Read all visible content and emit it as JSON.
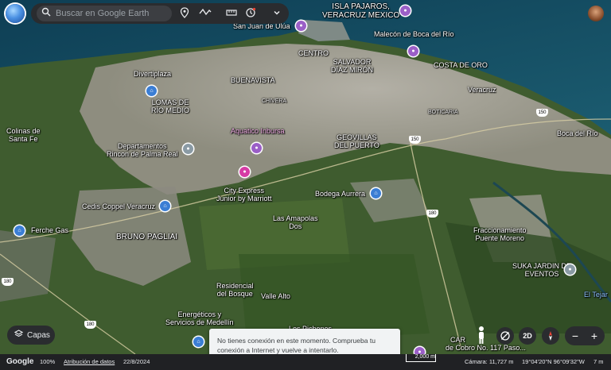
{
  "search": {
    "placeholder": "Buscar en Google Earth"
  },
  "toolbar": {
    "search_icon": "search-icon",
    "pin_icon": "place-icon",
    "path_icon": "path-icon",
    "ruler_icon": "ruler-icon",
    "history_icon": "history-icon",
    "chevron_icon": "chevron-down-icon"
  },
  "labels": {
    "isla_pajaros": "ISLA PAJAROS,",
    "isla_pajaros2": "VERACRUZ MEXICO",
    "san_juan": "San Juan de Ulúa",
    "malecon": "Malecón de Boca del Río",
    "centro": "CENTRO",
    "salvador": "SALVADOR",
    "salvador2": "DÍAZ MIRÓN",
    "costa_oro": "COSTA DE ORO",
    "divertiplaza": "Divertiplaza",
    "buenavista": "BUENAVISTA",
    "veracruz": "Veracruz",
    "lomas": "LOMAS DE",
    "lomas2": "RÍO MEDIO",
    "chivera": "CHIVERA",
    "boticaria": "BOTICARIA",
    "colinas": "Colinas de",
    "colinas2": "Santa Fe",
    "aquatico": "Aquatico Inbursa",
    "geovillas": "GEOVILLAS",
    "geovillas2": "DEL PUERTO",
    "boca": "Boca del Río",
    "departamentos": "Departamentos",
    "departamentos2": "Rincon de Palma Real",
    "cityexpress": "City Express",
    "cityexpress2": "Junior by Marriott",
    "bodega": "Bodega Aurrera",
    "cedis": "Cedis Coppel Veracruz",
    "amapolas": "Las Amapolas",
    "amapolas2": "Dos",
    "ferche": "Ferche Gas",
    "bruno": "BRUNO PAGLIAI",
    "fraccionamiento": "Fraccionamiento",
    "fraccionamiento2": "Puente Moreno",
    "suka": "SUKA JARDIN DE",
    "suka2": "EVENTOS",
    "residencial": "Residencial",
    "residencial2": "del Bosque",
    "valle": "Valle Alto",
    "eltejar": "El Tejar",
    "energeticos": "Energéticos y",
    "energeticos2": "Servicios de Medellín",
    "cobro": "de Cobro No. 117 Paso...",
    "cobro_prefix": "CAR",
    "pichones": "Los Pichones",
    "hwy150a": "150",
    "hwy150b": "150",
    "hwy180a": "180",
    "hwy180b": "180",
    "hwy180c": "180"
  },
  "layers": {
    "label": "Capas"
  },
  "toast": {
    "text": "No tienes conexión en este momento. Comprueba tu conexión a Internet y vuelve a intentarlo."
  },
  "controls": {
    "twod": "2D",
    "zoom_out": "−",
    "zoom_in": "+"
  },
  "status": {
    "brand": "Google",
    "zoom": "100%",
    "attribution": "Atribución de datos",
    "date": "22/8/2024",
    "scale": "2,000 m",
    "camera": "Cámara: 11,727 m",
    "coords": "19°04'20\"N 96°09'32\"W",
    "elevation": "7 m"
  }
}
